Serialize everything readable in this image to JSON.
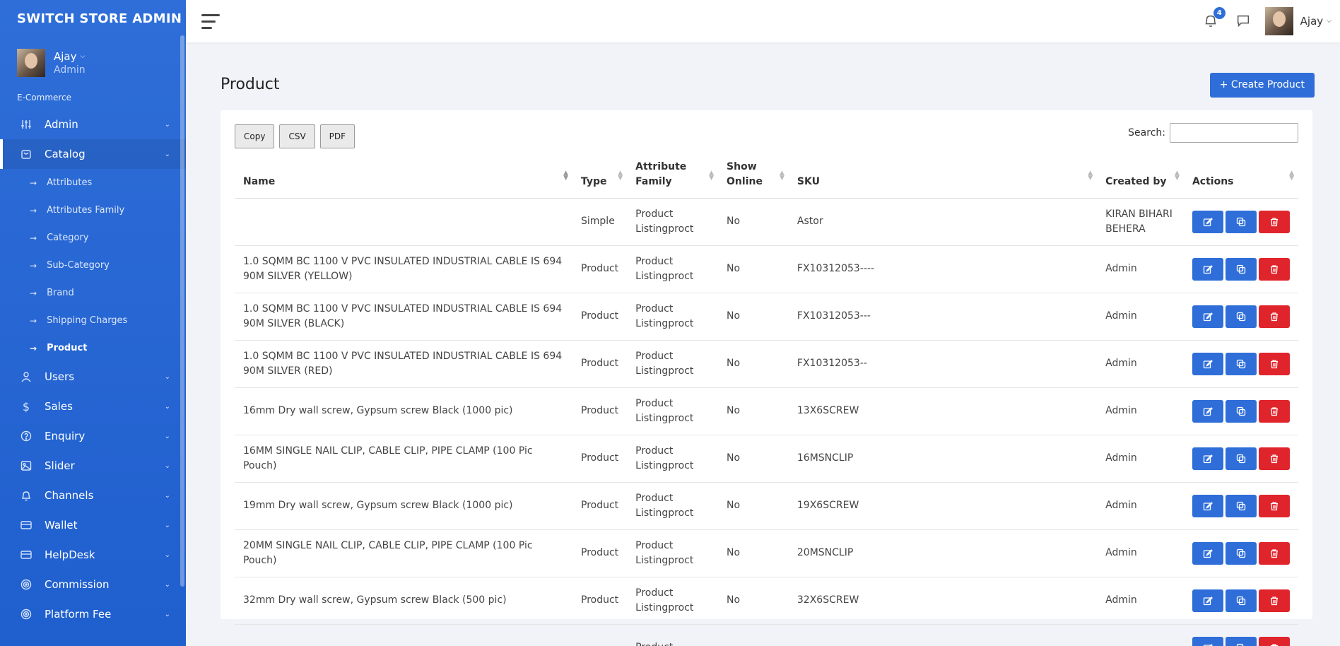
{
  "sidebar": {
    "brand": "SWITCH STORE ADMIN",
    "user_name": "Ajay",
    "user_role": "Admin",
    "section": "E-Commerce",
    "items": [
      {
        "label": "Admin"
      },
      {
        "label": "Catalog"
      },
      {
        "label": "Users"
      },
      {
        "label": "Sales"
      },
      {
        "label": "Enquiry"
      },
      {
        "label": "Slider"
      },
      {
        "label": "Channels"
      },
      {
        "label": "Wallet"
      },
      {
        "label": "HelpDesk"
      },
      {
        "label": "Commission"
      },
      {
        "label": "Platform Fee"
      }
    ],
    "catalog_sub": [
      {
        "label": "Attributes"
      },
      {
        "label": "Attributes Family"
      },
      {
        "label": "Category"
      },
      {
        "label": "Sub-Category"
      },
      {
        "label": "Brand"
      },
      {
        "label": "Shipping Charges"
      },
      {
        "label": "Product"
      }
    ]
  },
  "topbar": {
    "notification_count": "4",
    "user_name": "Ajay"
  },
  "page": {
    "title": "Product",
    "create_label": "+ Create Product"
  },
  "toolbar": {
    "copy": "Copy",
    "csv": "CSV",
    "pdf": "PDF",
    "search_label": "Search:"
  },
  "table": {
    "headers": {
      "name": "Name",
      "type": "Type",
      "attr_family": "Attribute Family",
      "show_online": "Show Online",
      "sku": "SKU",
      "created_by": "Created by",
      "actions": "Actions"
    },
    "rows": [
      {
        "name": "",
        "type": "Simple",
        "family": "Product Listingproct",
        "online": "No",
        "sku": "Astor",
        "created": "KIRAN BIHARI BEHERA"
      },
      {
        "name": "1.0 SQMM BC 1100 V PVC INSULATED INDUSTRIAL CABLE IS 694 90M SILVER (YELLOW)",
        "type": "Product",
        "family": "Product Listingproct",
        "online": "No",
        "sku": "FX10312053----",
        "created": "Admin"
      },
      {
        "name": "1.0 SQMM BC 1100 V PVC INSULATED INDUSTRIAL CABLE IS 694 90M SILVER (BLACK)",
        "type": "Product",
        "family": "Product Listingproct",
        "online": "No",
        "sku": "FX10312053---",
        "created": "Admin"
      },
      {
        "name": "1.0 SQMM BC 1100 V PVC INSULATED INDUSTRIAL CABLE IS 694 90M SILVER (RED)",
        "type": "Product",
        "family": "Product Listingproct",
        "online": "No",
        "sku": "FX10312053--",
        "created": "Admin"
      },
      {
        "name": "16mm Dry wall screw, Gypsum screw Black (1000 pic)",
        "type": "Product",
        "family": "Product Listingproct",
        "online": "No",
        "sku": "13X6SCREW",
        "created": "Admin"
      },
      {
        "name": "16MM SINGLE NAIL CLIP, CABLE CLIP, PIPE CLAMP (100 Pic Pouch)",
        "type": "Product",
        "family": "Product Listingproct",
        "online": "No",
        "sku": "16MSNCLIP",
        "created": "Admin"
      },
      {
        "name": "19mm Dry wall screw, Gypsum screw Black (1000 pic)",
        "type": "Product",
        "family": "Product Listingproct",
        "online": "No",
        "sku": "19X6SCREW",
        "created": "Admin"
      },
      {
        "name": "20MM SINGLE NAIL CLIP, CABLE CLIP, PIPE CLAMP (100 Pic Pouch)",
        "type": "Product",
        "family": "Product Listingproct",
        "online": "No",
        "sku": "20MSNCLIP",
        "created": "Admin"
      },
      {
        "name": "32mm Dry wall screw, Gypsum screw Black (500 pic)",
        "type": "Product",
        "family": "Product Listingproct",
        "online": "No",
        "sku": "32X6SCREW",
        "created": "Admin"
      },
      {
        "name": "",
        "type": "",
        "family": "Product",
        "online": "",
        "sku": "",
        "created": ""
      }
    ]
  }
}
